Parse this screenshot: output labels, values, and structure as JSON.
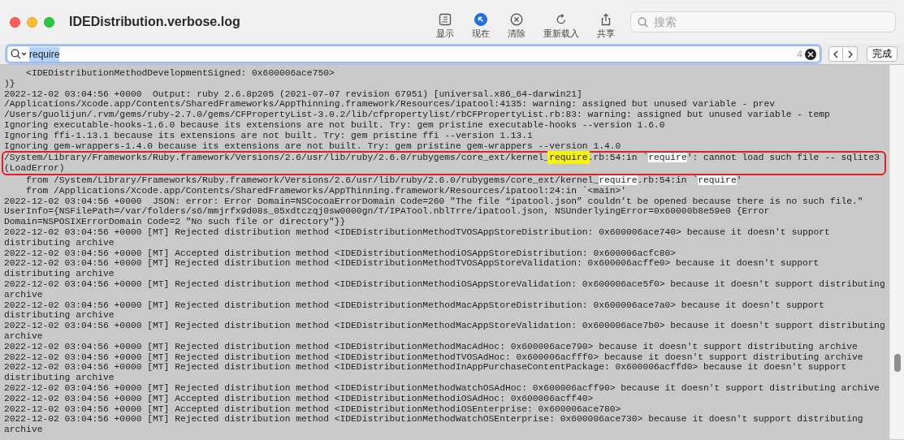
{
  "window": {
    "title": "IDEDistribution.verbose.log"
  },
  "toolbar": {
    "buttons": [
      {
        "label": "显示",
        "selected": false
      },
      {
        "label": "现在",
        "selected": true
      },
      {
        "label": "清除",
        "selected": false
      },
      {
        "label": "重新载入",
        "selected": false
      },
      {
        "label": "共享",
        "selected": false
      }
    ],
    "search": {
      "placeholder": "搜索"
    }
  },
  "find_bar": {
    "query": "require",
    "query_selected": true,
    "match_count": "4",
    "done_button": "完成"
  },
  "log": {
    "blocks": [
      {
        "boxed": false,
        "lines": [
          [
            {
              "text": "    <IDEDistributionMethodDevelopmentSigned: 0x600006ace750>",
              "kind": "plain"
            }
          ],
          [
            {
              "text": ")}",
              "kind": "plain"
            }
          ],
          [
            {
              "text": "2022-12-02 03:04:56 +0000  Output: ruby 2.6.8p205 (2021-07-07 revision 67951) [universal.x86_64-darwin21]",
              "kind": "plain"
            }
          ],
          [
            {
              "text": "/Applications/Xcode.app/Contents/SharedFrameworks/AppThinning.framework/Resources/ipatool:4135: warning: assigned but unused variable - prev",
              "kind": "plain"
            }
          ],
          [
            {
              "text": "/Users/guolijun/.rvm/gems/ruby-2.7.0/gems/CFPropertyList-3.0.2/lib/cfpropertylist/rbCFPropertyList.rb:83: warning: assigned but unused variable - temp",
              "kind": "plain"
            }
          ],
          [
            {
              "text": "Ignoring executable-hooks-1.6.0 because its extensions are not built. Try: gem pristine executable-hooks --version 1.6.0",
              "kind": "plain"
            }
          ],
          [
            {
              "text": "Ignoring ffi-1.13.1 because its extensions are not built. Try: gem pristine ffi --version 1.13.1",
              "kind": "plain"
            }
          ],
          [
            {
              "text": "Ignoring gem-wrappers-1.4.0 because its extensions are not built. Try: gem pristine gem-wrappers --version 1.4.0",
              "kind": "plain"
            }
          ]
        ]
      },
      {
        "boxed": true,
        "lines": [
          [
            {
              "text": "/System/Library/Frameworks/Ruby.framework/Versions/2.6/usr/lib/ruby/2.6.0/rubygems/core_ext/kernel_",
              "kind": "plain"
            },
            {
              "text": "require",
              "kind": "current"
            },
            {
              "text": ".rb:54:in `",
              "kind": "plain"
            },
            {
              "text": "require",
              "kind": "match"
            },
            {
              "text": "': cannot load such file -- sqlite3",
              "kind": "plain"
            }
          ],
          [
            {
              "text": "(LoadError)",
              "kind": "plain"
            }
          ]
        ]
      },
      {
        "boxed": false,
        "lines": [
          [
            {
              "text": "    from /System/Library/Frameworks/Ruby.framework/Versions/2.6/usr/lib/ruby/2.6.0/rubygems/core_ext/kernel_",
              "kind": "plain"
            },
            {
              "text": "require",
              "kind": "match"
            },
            {
              "text": ".rb:54:in `",
              "kind": "plain"
            },
            {
              "text": "require",
              "kind": "match"
            },
            {
              "text": "'",
              "kind": "plain"
            }
          ],
          [
            {
              "text": "    from /Applications/Xcode.app/Contents/SharedFrameworks/AppThinning.framework/Resources/ipatool:24:in `<main>'",
              "kind": "plain"
            }
          ],
          [
            {
              "text": "2022-12-02 03:04:56 +0000  JSON: error: Error Domain=NSCocoaErrorDomain Code=260 \"The file “ipatool.json” couldn’t be opened because there is no such file.\"",
              "kind": "plain"
            }
          ],
          [
            {
              "text": "UserInfo={NSFilePath=/var/folders/s6/mmjrfx9d08s_05xdtczqj0sw0000gn/T/IPATool.nblTrre/ipatool.json, NSUnderlyingError=0x60000b8e59e0 {Error",
              "kind": "plain"
            }
          ],
          [
            {
              "text": "Domain=NSPOSIXErrorDomain Code=2 \"No such file or directory\"}}",
              "kind": "plain"
            }
          ],
          [
            {
              "text": "2022-12-02 03:04:56 +0000 [MT] Rejected distribution method <IDEDistributionMethodTVOSAppStoreDistribution: 0x600006ace740> because it doesn't support",
              "kind": "plain"
            }
          ],
          [
            {
              "text": "distributing archive",
              "kind": "plain"
            }
          ],
          [
            {
              "text": "2022-12-02 03:04:56 +0000 [MT] Accepted distribution method <IDEDistributionMethodiOSAppStoreDistribution: 0x600006acfc80>",
              "kind": "plain"
            }
          ],
          [
            {
              "text": "2022-12-02 03:04:56 +0000 [MT] Rejected distribution method <IDEDistributionMethodTVOSAppStoreValidation: 0x600006acffe0> because it doesn't support",
              "kind": "plain"
            }
          ],
          [
            {
              "text": "distributing archive",
              "kind": "plain"
            }
          ],
          [
            {
              "text": "2022-12-02 03:04:56 +0000 [MT] Rejected distribution method <IDEDistributionMethodiOSAppStoreValidation: 0x600006ace5f0> because it doesn't support distributing",
              "kind": "plain"
            }
          ],
          [
            {
              "text": "archive",
              "kind": "plain"
            }
          ],
          [
            {
              "text": "2022-12-02 03:04:56 +0000 [MT] Rejected distribution method <IDEDistributionMethodMacAppStoreDistribution: 0x600006ace7a0> because it doesn't support",
              "kind": "plain"
            }
          ],
          [
            {
              "text": "distributing archive",
              "kind": "plain"
            }
          ],
          [
            {
              "text": "2022-12-02 03:04:56 +0000 [MT] Rejected distribution method <IDEDistributionMethodMacAppStoreValidation: 0x600006ace7b0> because it doesn't support distributing",
              "kind": "plain"
            }
          ],
          [
            {
              "text": "archive",
              "kind": "plain"
            }
          ],
          [
            {
              "text": "2022-12-02 03:04:56 +0000 [MT] Rejected distribution method <IDEDistributionMethodMacAdHoc: 0x600006ace790> because it doesn't support distributing archive",
              "kind": "plain"
            }
          ],
          [
            {
              "text": "2022-12-02 03:04:56 +0000 [MT] Rejected distribution method <IDEDistributionMethodTVOSAdHoc: 0x600006acfff0> because it doesn't support distributing archive",
              "kind": "plain"
            }
          ],
          [
            {
              "text": "2022-12-02 03:04:56 +0000 [MT] Rejected distribution method <IDEDistributionMethodInAppPurchaseContentPackage: 0x600006acffd0> because it doesn't support",
              "kind": "plain"
            }
          ],
          [
            {
              "text": "distributing archive",
              "kind": "plain"
            }
          ],
          [
            {
              "text": "2022-12-02 03:04:56 +0000 [MT] Rejected distribution method <IDEDistributionMethodWatchOSAdHoc: 0x600006acff90> because it doesn't support distributing archive",
              "kind": "plain"
            }
          ],
          [
            {
              "text": "2022-12-02 03:04:56 +0000 [MT] Accepted distribution method <IDEDistributionMethodiOSAdHoc: 0x600006acff40>",
              "kind": "plain"
            }
          ],
          [
            {
              "text": "2022-12-02 03:04:56 +0000 [MT] Accepted distribution method <IDEDistributionMethodiOSEnterprise: 0x600006ace780>",
              "kind": "plain"
            }
          ],
          [
            {
              "text": "2022-12-02 03:04:56 +0000 [MT] Rejected distribution method <IDEDistributionMethodWatchOSEnterprise: 0x600006ace730> because it doesn't support distributing",
              "kind": "plain"
            }
          ],
          [
            {
              "text": "archive",
              "kind": "plain"
            }
          ]
        ]
      }
    ]
  }
}
